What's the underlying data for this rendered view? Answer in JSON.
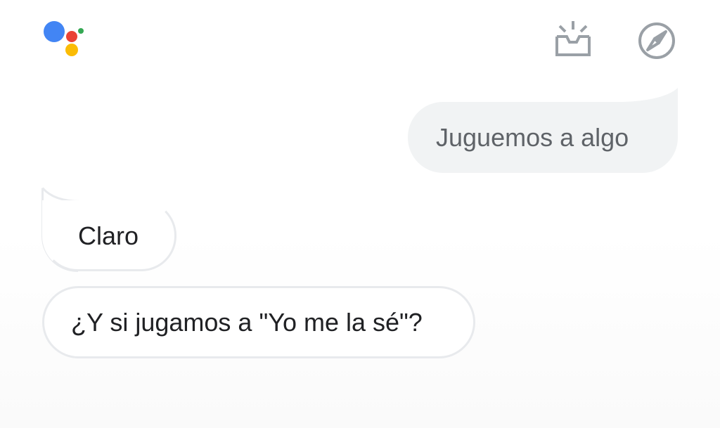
{
  "header": {
    "logo_icon": "google-assistant-logo",
    "logo_colors": {
      "blue": "#4285F4",
      "red": "#EA4335",
      "yellow": "#FBBC05",
      "green": "#34A853"
    },
    "updates_icon": "updates-inbox-icon",
    "explore_icon": "explore-compass-icon",
    "icon_color": "#9AA0A6"
  },
  "conversation": {
    "messages": [
      {
        "sender": "user",
        "text": "Juguemos a algo"
      },
      {
        "sender": "assistant",
        "text": "Claro"
      },
      {
        "sender": "assistant",
        "text": "¿Y si jugamos a \"Yo me la sé\"?"
      }
    ]
  },
  "colors": {
    "user_bubble_bg": "#F1F3F4",
    "user_text": "#5F6368",
    "assistant_border": "#E8EAED",
    "assistant_text": "#202124"
  }
}
